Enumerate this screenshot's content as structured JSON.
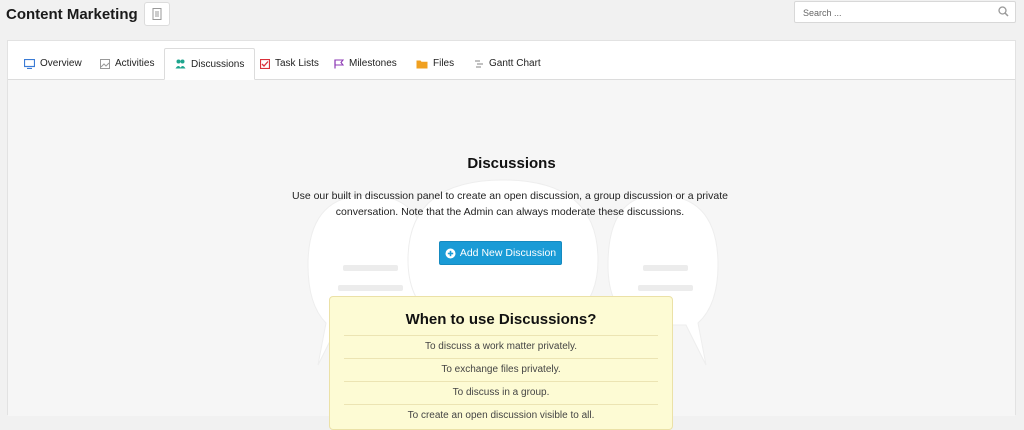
{
  "header": {
    "title": "Content Marketing",
    "search_placeholder": "Search ..."
  },
  "tabs": [
    {
      "label": "Overview",
      "icon": "monitor-icon",
      "color": "#3a7bd5"
    },
    {
      "label": "Activities",
      "icon": "image-icon",
      "color": "#888888"
    },
    {
      "label": "Discussions",
      "icon": "users-icon",
      "color": "#1ea58e",
      "active": true
    },
    {
      "label": "Task Lists",
      "icon": "checklist-icon",
      "color": "#d9303a"
    },
    {
      "label": "Milestones",
      "icon": "flag-icon",
      "color": "#8e3bb5"
    },
    {
      "label": "Files",
      "icon": "folder-icon",
      "color": "#f0a020"
    },
    {
      "label": "Gantt Chart",
      "icon": "gantt-icon",
      "color": "#888888"
    }
  ],
  "main": {
    "heading": "Discussions",
    "description": "Use our built in discussion panel to create an open discussion, a group discussion or a private conversation. Note that the Admin can always moderate these discussions.",
    "add_button_label": "Add New Discussion"
  },
  "when_box": {
    "title": "When to use Discussions?",
    "items": [
      "To discuss a work matter privately.",
      "To exchange files privately.",
      "To discuss in a group.",
      "To create an open discussion visible to all."
    ]
  },
  "colors": {
    "accent_button": "#1a9bd6",
    "info_box_bg": "#fdfbd4"
  }
}
